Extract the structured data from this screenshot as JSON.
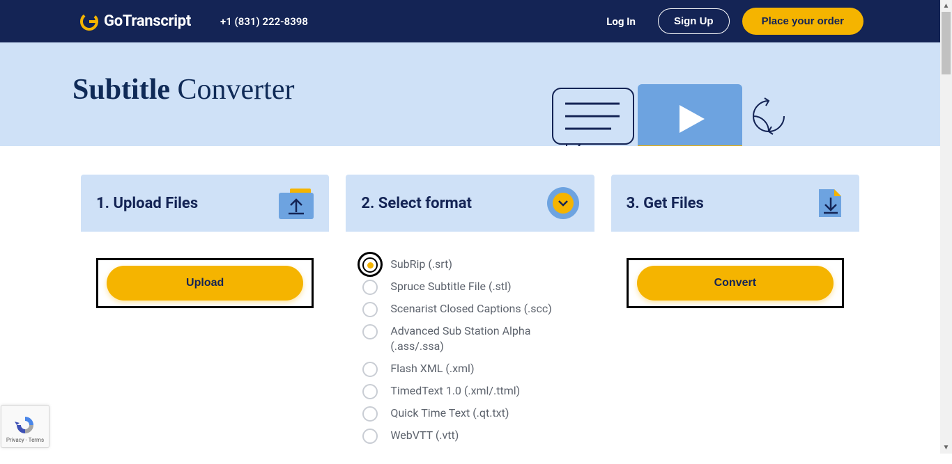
{
  "header": {
    "brand": "GoTranscript",
    "phone": "+1 (831) 222-8398",
    "login": "Log In",
    "signup": "Sign Up",
    "order": "Place your order"
  },
  "hero": {
    "title_bold": "Subtitle",
    "title_rest": "Converter"
  },
  "cards": {
    "upload": {
      "title": "1. Upload Files",
      "button": "Upload"
    },
    "select": {
      "title": "2. Select format",
      "options": [
        {
          "label": "SubRip (.srt)",
          "checked": true
        },
        {
          "label": "Spruce Subtitle File (.stl)",
          "checked": false
        },
        {
          "label": "Scenarist Closed Captions (.scc)",
          "checked": false
        },
        {
          "label": "Advanced Sub Station Alpha (.ass/.ssa)",
          "checked": false
        },
        {
          "label": "Flash XML (.xml)",
          "checked": false
        },
        {
          "label": "TimedText 1.0 (.xml/.ttml)",
          "checked": false
        },
        {
          "label": "Quick Time Text (.qt.txt)",
          "checked": false
        },
        {
          "label": "WebVTT (.vtt)",
          "checked": false
        }
      ]
    },
    "get": {
      "title": "3. Get Files",
      "button": "Convert"
    }
  },
  "recaptcha": {
    "text": "Privacy - Terms"
  }
}
